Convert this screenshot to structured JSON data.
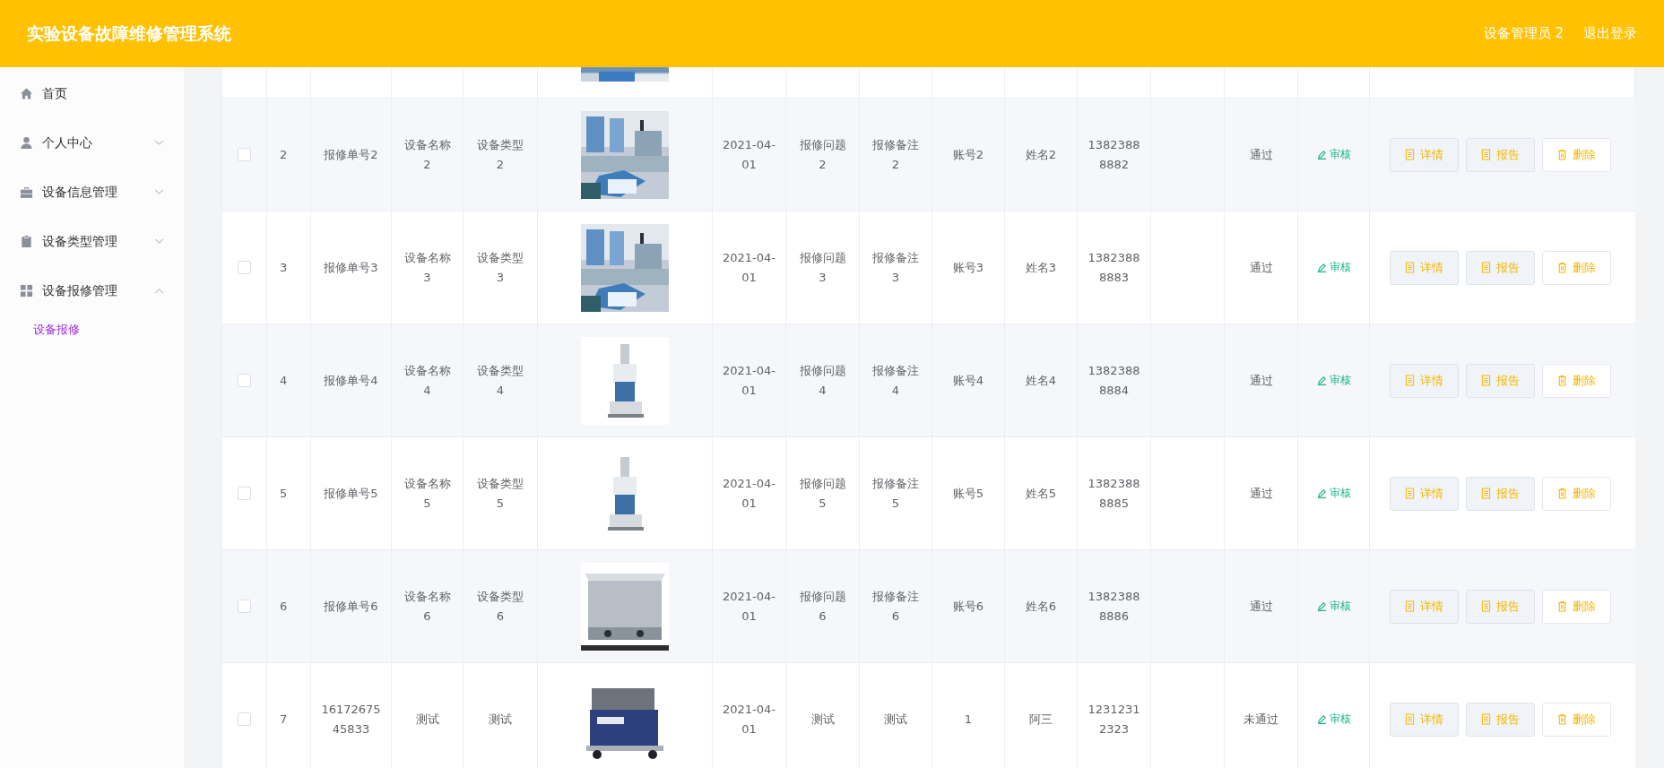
{
  "header": {
    "title": "实验设备故障维修管理系统",
    "user": "设备管理员 2",
    "logout": "退出登录"
  },
  "sidebar": {
    "items": [
      {
        "kind": "link",
        "label": "首页"
      },
      {
        "kind": "menu",
        "label": "个人中心",
        "expanded": false
      },
      {
        "kind": "menu",
        "label": "设备信息管理",
        "expanded": false
      },
      {
        "kind": "menu",
        "label": "设备类型管理",
        "expanded": false
      },
      {
        "kind": "menu",
        "label": "设备报修管理",
        "expanded": true,
        "children": [
          {
            "label": "设备报修",
            "selected": true
          }
        ]
      }
    ]
  },
  "table": {
    "rows": [
      {
        "checked": false,
        "index": "2",
        "order_no": "报修单号2",
        "device_name": "设备名称2",
        "device_type": "设备类型2",
        "date": "2021-04-01",
        "problem": "报修问题2",
        "remark": "报修备注2",
        "account": "账号2",
        "name": "姓名2",
        "phone": "13823888882",
        "status": "通过",
        "review": "审核",
        "actions": [
          {
            "kind": "detail",
            "label": "详情"
          },
          {
            "kind": "report",
            "label": "报告"
          },
          {
            "kind": "delete",
            "label": "删除"
          }
        ]
      },
      {
        "checked": false,
        "index": "3",
        "order_no": "报修单号3",
        "device_name": "设备名称3",
        "device_type": "设备类型3",
        "date": "2021-04-01",
        "problem": "报修问题3",
        "remark": "报修备注3",
        "account": "账号3",
        "name": "姓名3",
        "phone": "13823888883",
        "status": "通过",
        "review": "审核",
        "actions": [
          {
            "kind": "detail",
            "label": "详情"
          },
          {
            "kind": "report",
            "label": "报告"
          },
          {
            "kind": "delete",
            "label": "删除"
          }
        ]
      },
      {
        "checked": false,
        "index": "4",
        "order_no": "报修单号4",
        "device_name": "设备名称4",
        "device_type": "设备类型4",
        "date": "2021-04-01",
        "problem": "报修问题4",
        "remark": "报修备注4",
        "account": "账号4",
        "name": "姓名4",
        "phone": "13823888884",
        "status": "通过",
        "review": "审核",
        "actions": [
          {
            "kind": "detail",
            "label": "详情"
          },
          {
            "kind": "report",
            "label": "报告"
          },
          {
            "kind": "delete",
            "label": "删除"
          }
        ]
      },
      {
        "checked": false,
        "index": "5",
        "order_no": "报修单号5",
        "device_name": "设备名称5",
        "device_type": "设备类型5",
        "date": "2021-04-01",
        "problem": "报修问题5",
        "remark": "报修备注5",
        "account": "账号5",
        "name": "姓名5",
        "phone": "13823888885",
        "status": "通过",
        "review": "审核",
        "actions": [
          {
            "kind": "detail",
            "label": "详情"
          },
          {
            "kind": "report",
            "label": "报告"
          },
          {
            "kind": "delete",
            "label": "删除"
          }
        ]
      },
      {
        "checked": false,
        "index": "6",
        "order_no": "报修单号6",
        "device_name": "设备名称6",
        "device_type": "设备类型6",
        "date": "2021-04-01",
        "problem": "报修问题6",
        "remark": "报修备注6",
        "account": "账号6",
        "name": "姓名6",
        "phone": "13823888886",
        "status": "通过",
        "review": "审核",
        "actions": [
          {
            "kind": "detail",
            "label": "详情"
          },
          {
            "kind": "report",
            "label": "报告"
          },
          {
            "kind": "delete",
            "label": "删除"
          }
        ]
      },
      {
        "checked": false,
        "index": "7",
        "order_no": "1617267545833",
        "device_name": "测试",
        "device_type": "测试",
        "date": "2021-04-01",
        "problem": "测试",
        "remark": "测试",
        "account": "1",
        "name": "阿三",
        "phone": "12312312323",
        "status": "未通过",
        "review": "审核",
        "actions": [
          {
            "kind": "detail",
            "label": "详情"
          },
          {
            "kind": "report",
            "label": "报告"
          },
          {
            "kind": "delete",
            "label": "删除"
          }
        ]
      }
    ]
  }
}
